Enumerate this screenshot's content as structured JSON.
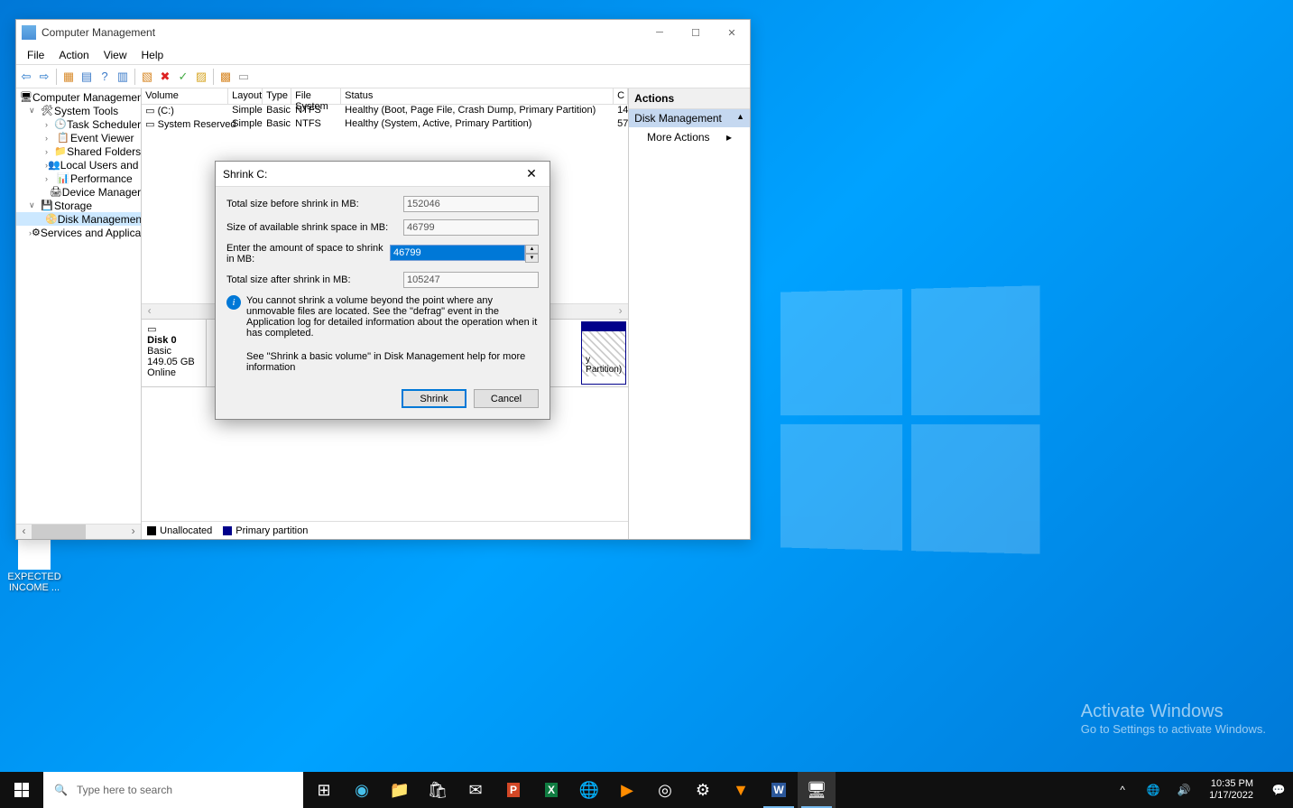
{
  "desktop": {
    "icon_label": "EXPECTED INCOME ...",
    "activate_title": "Activate Windows",
    "activate_sub": "Go to Settings to activate Windows."
  },
  "window": {
    "title": "Computer Management",
    "menu": {
      "file": "File",
      "action": "Action",
      "view": "View",
      "help": "Help"
    }
  },
  "tree": {
    "root": "Computer Management (Local",
    "system_tools": "System Tools",
    "task_scheduler": "Task Scheduler",
    "event_viewer": "Event Viewer",
    "shared_folders": "Shared Folders",
    "local_users": "Local Users and Groups",
    "performance": "Performance",
    "device_manager": "Device Manager",
    "storage": "Storage",
    "disk_mgmt": "Disk Management",
    "services": "Services and Applications"
  },
  "vt": {
    "h_volume": "Volume",
    "h_layout": "Layout",
    "h_type": "Type",
    "h_fs": "File System",
    "h_status": "Status",
    "h_c": "C",
    "rows": [
      {
        "vol": "(C:)",
        "layout": "Simple",
        "type": "Basic",
        "fs": "NTFS",
        "status": "Healthy (Boot, Page File, Crash Dump, Primary Partition)",
        "c": "14"
      },
      {
        "vol": "System Reserved",
        "layout": "Simple",
        "type": "Basic",
        "fs": "NTFS",
        "status": "Healthy (System, Active, Primary Partition)",
        "c": "57"
      }
    ]
  },
  "disk": {
    "name": "Disk 0",
    "type": "Basic",
    "size": "149.05 GB",
    "state": "Online",
    "part_label": "y Partition)"
  },
  "legend": {
    "unalloc": "Unallocated",
    "primary": "Primary partition"
  },
  "actions": {
    "head": "Actions",
    "selected": "Disk Management",
    "more": "More Actions"
  },
  "dialog": {
    "title": "Shrink C:",
    "l_total_before": "Total size before shrink in MB:",
    "v_total_before": "152046",
    "l_avail": "Size of available shrink space in MB:",
    "v_avail": "46799",
    "l_enter": "Enter the amount of space to shrink in MB:",
    "v_enter": "46799",
    "l_total_after": "Total size after shrink in MB:",
    "v_total_after": "105247",
    "info1": "You cannot shrink a volume beyond the point where any unmovable files are located. See the \"defrag\" event in the Application log for detailed information about the operation when it has completed.",
    "info2": "See \"Shrink a basic volume\" in Disk Management help for more information",
    "btn_shrink": "Shrink",
    "btn_cancel": "Cancel"
  },
  "taskbar": {
    "search_placeholder": "Type here to search",
    "time": "10:35 PM",
    "date": "1/17/2022"
  }
}
